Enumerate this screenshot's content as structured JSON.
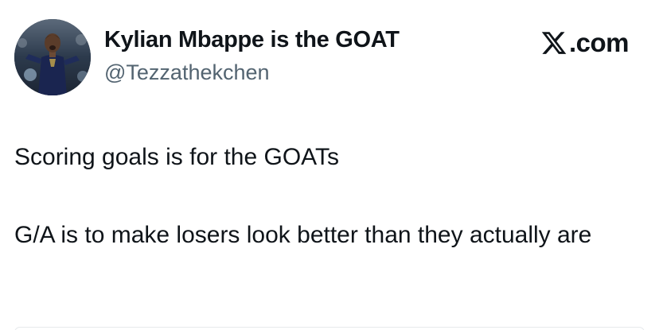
{
  "tweet": {
    "author": {
      "display_name": "Kylian Mbappe is the GOAT",
      "handle": "@Tezzathekchen",
      "avatar_icon": "profile-photo-football-player"
    },
    "brand": {
      "icon": "x-logo-icon",
      "text": ".com"
    },
    "text_paragraphs": [
      "Scoring goals is for the GOATs",
      "G/A is to make losers look better than they actually are"
    ]
  },
  "colors": {
    "text_primary": "#0f1419",
    "text_secondary": "#536471",
    "background": "#ffffff"
  }
}
